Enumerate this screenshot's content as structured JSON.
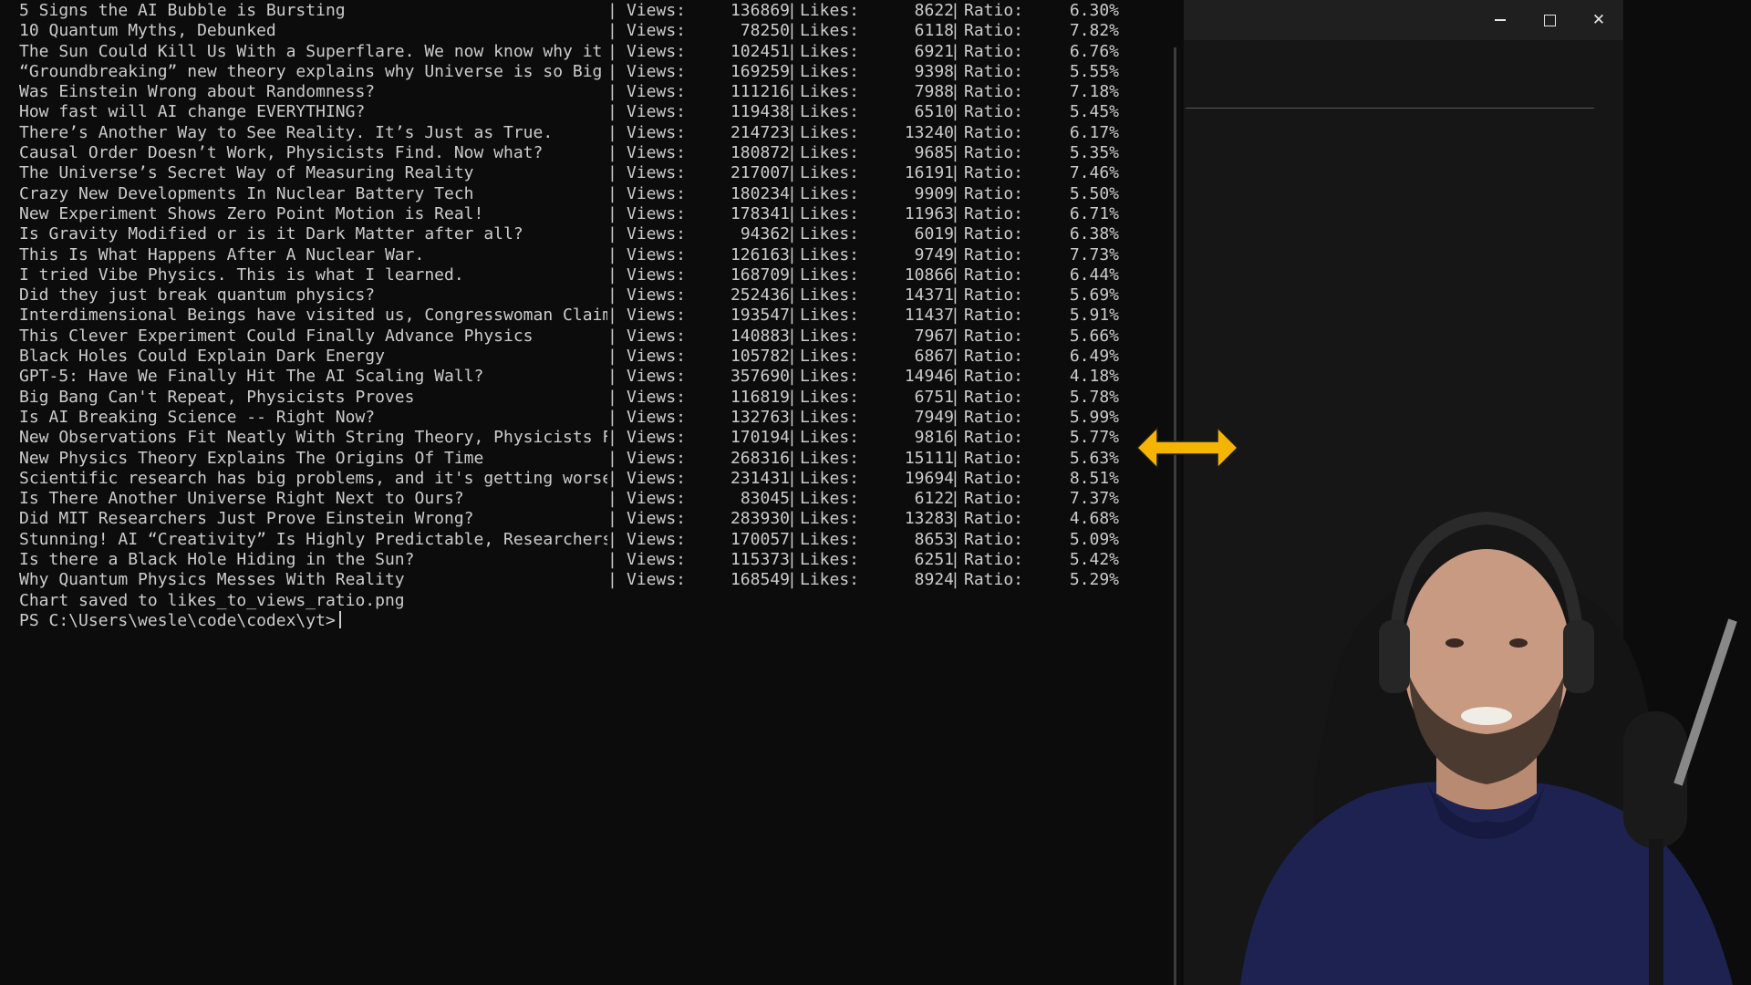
{
  "terminal": {
    "rows": [
      {
        "title": "5 Signs the AI Bubble is Bursting",
        "views": "136869",
        "likes": "8622",
        "ratio": "6.30%"
      },
      {
        "title": "10 Quantum Myths, Debunked",
        "views": "78250",
        "likes": "6118",
        "ratio": "7.82%"
      },
      {
        "title": "The Sun Could Kill Us With a Superflare. We now know why it",
        "views": "102451",
        "likes": "6921",
        "ratio": "6.76%"
      },
      {
        "title": "“Groundbreaking” new theory explains why Universe is so Big",
        "views": "169259",
        "likes": "9398",
        "ratio": "5.55%"
      },
      {
        "title": "Was Einstein Wrong about Randomness?",
        "views": "111216",
        "likes": "7988",
        "ratio": "7.18%"
      },
      {
        "title": "How fast will AI change EVERYTHING?",
        "views": "119438",
        "likes": "6510",
        "ratio": "5.45%"
      },
      {
        "title": "There’s Another Way to See Reality. It’s Just as True.",
        "views": "214723",
        "likes": "13240",
        "ratio": "6.17%"
      },
      {
        "title": "Causal Order Doesn’t Work, Physicists Find. Now what?",
        "views": "180872",
        "likes": "9685",
        "ratio": "5.35%"
      },
      {
        "title": "The Universe’s Secret Way of Measuring Reality",
        "views": "217007",
        "likes": "16191",
        "ratio": "7.46%"
      },
      {
        "title": "Crazy New Developments In Nuclear Battery Tech",
        "views": "180234",
        "likes": "9909",
        "ratio": "5.50%"
      },
      {
        "title": "New Experiment Shows Zero Point Motion is Real!",
        "views": "178341",
        "likes": "11963",
        "ratio": "6.71%"
      },
      {
        "title": "Is Gravity Modified or is it Dark Matter after all?",
        "views": "94362",
        "likes": "6019",
        "ratio": "6.38%"
      },
      {
        "title": "This Is What Happens After A Nuclear War.",
        "views": "126163",
        "likes": "9749",
        "ratio": "7.73%"
      },
      {
        "title": "I tried Vibe Physics. This is what I learned.",
        "views": "168709",
        "likes": "10866",
        "ratio": "6.44%"
      },
      {
        "title": "Did they just break quantum physics?",
        "views": "252436",
        "likes": "14371",
        "ratio": "5.69%"
      },
      {
        "title": "Interdimensional Beings have visited us, Congresswoman Claim",
        "views": "193547",
        "likes": "11437",
        "ratio": "5.91%"
      },
      {
        "title": "This Clever Experiment Could Finally Advance Physics",
        "views": "140883",
        "likes": "7967",
        "ratio": "5.66%"
      },
      {
        "title": "Black Holes Could Explain Dark Energy",
        "views": "105782",
        "likes": "6867",
        "ratio": "6.49%"
      },
      {
        "title": "GPT-5: Have We Finally Hit The AI Scaling Wall?",
        "views": "357690",
        "likes": "14946",
        "ratio": "4.18%"
      },
      {
        "title": "Big Bang Can't Repeat, Physicists Proves",
        "views": "116819",
        "likes": "6751",
        "ratio": "5.78%"
      },
      {
        "title": "Is AI Breaking Science -- Right Now?",
        "views": "132763",
        "likes": "7949",
        "ratio": "5.99%"
      },
      {
        "title": "New Observations Fit Neatly With String Theory, Physicists F",
        "views": "170194",
        "likes": "9816",
        "ratio": "5.77%"
      },
      {
        "title": "New Physics Theory Explains The Origins Of Time",
        "views": "268316",
        "likes": "15111",
        "ratio": "5.63%"
      },
      {
        "title": "Scientific research has big problems, and it's getting worse",
        "views": "231431",
        "likes": "19694",
        "ratio": "8.51%"
      },
      {
        "title": "Is There Another Universe Right Next to Ours?",
        "views": "83045",
        "likes": "6122",
        "ratio": "7.37%"
      },
      {
        "title": "Did MIT Researchers Just Prove Einstein Wrong?",
        "views": "283930",
        "likes": "13283",
        "ratio": "4.68%"
      },
      {
        "title": "Stunning! AI “Creativity” Is Highly Predictable, Researchers",
        "views": "170057",
        "likes": "8653",
        "ratio": "5.09%"
      },
      {
        "title": "Is there a Black Hole Hiding in the Sun?",
        "views": "115373",
        "likes": "6251",
        "ratio": "5.42%"
      },
      {
        "title": "Why Quantum Physics Messes With Reality",
        "views": "168549",
        "likes": "8924",
        "ratio": "5.29%"
      }
    ],
    "labels": {
      "views": "Views:",
      "likes": "Likes:",
      "ratio": "Ratio:",
      "separator": "|"
    },
    "saved_message": "Chart saved to likes_to_views_ratio.png",
    "prompt": "PS C:\\Users\\wesle\\code\\codex\\yt>"
  },
  "window2": {
    "minimize_glyph": "–",
    "maximize_glyph": "☐",
    "close_glyph": "✕"
  },
  "colors": {
    "terminal_bg": "#0c0c0c",
    "terminal_text": "#cccccc",
    "arrow": "#f5b400",
    "window_bg": "#161616"
  },
  "overlay": {
    "icon": "resize-horizontal-icon"
  },
  "webcam": {
    "icon": "person-with-headphones"
  }
}
